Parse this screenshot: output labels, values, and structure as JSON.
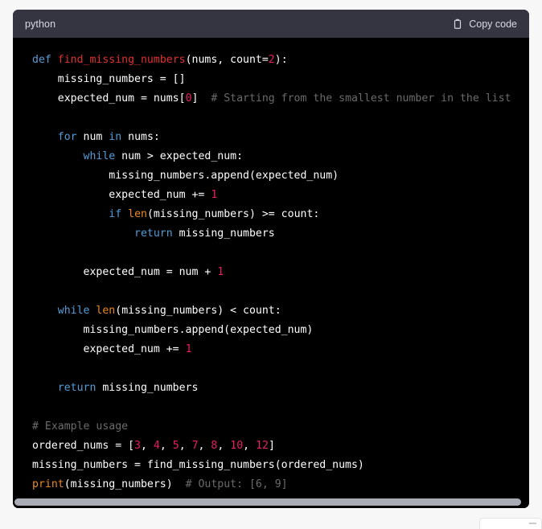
{
  "code_block": {
    "language_label": "python",
    "copy_button_label": "Copy code",
    "copy_icon": "clipboard-icon",
    "scrollbar": {
      "orientation": "horizontal",
      "visible": true
    },
    "colors": {
      "page_background": "#f7f7f8",
      "header_background": "#343541",
      "code_background": "#000000",
      "keyword": "#569cd6",
      "function_name": "#e03131",
      "number": "#e91e63",
      "builtin": "#e8892a",
      "comment": "#6b6b6b",
      "plain_text": "#ffffff",
      "scrollbar_thumb": "#a9abb5"
    },
    "lines": [
      {
        "n": 1,
        "tokens": [
          {
            "t": "def",
            "c": "kw"
          },
          {
            "t": " ",
            "c": "pl"
          },
          {
            "t": "find_missing_numbers",
            "c": "fn"
          },
          {
            "t": "(nums, count=",
            "c": "pl"
          },
          {
            "t": "2",
            "c": "num"
          },
          {
            "t": "):",
            "c": "pl"
          }
        ]
      },
      {
        "n": 2,
        "tokens": [
          {
            "t": "    missing_numbers = []",
            "c": "pl"
          }
        ]
      },
      {
        "n": 3,
        "tokens": [
          {
            "t": "    expected_num = nums[",
            "c": "pl"
          },
          {
            "t": "0",
            "c": "num"
          },
          {
            "t": "]  ",
            "c": "pl"
          },
          {
            "t": "# Starting from the smallest number in the list",
            "c": "cmt"
          }
        ]
      },
      {
        "n": 4,
        "tokens": [
          {
            "t": "",
            "c": "pl"
          }
        ]
      },
      {
        "n": 5,
        "tokens": [
          {
            "t": "    ",
            "c": "pl"
          },
          {
            "t": "for",
            "c": "kw"
          },
          {
            "t": " num ",
            "c": "pl"
          },
          {
            "t": "in",
            "c": "kw"
          },
          {
            "t": " nums:",
            "c": "pl"
          }
        ]
      },
      {
        "n": 6,
        "tokens": [
          {
            "t": "        ",
            "c": "pl"
          },
          {
            "t": "while",
            "c": "kw"
          },
          {
            "t": " num > expected_num:",
            "c": "pl"
          }
        ]
      },
      {
        "n": 7,
        "tokens": [
          {
            "t": "            missing_numbers.append(expected_num)",
            "c": "pl"
          }
        ]
      },
      {
        "n": 8,
        "tokens": [
          {
            "t": "            expected_num += ",
            "c": "pl"
          },
          {
            "t": "1",
            "c": "num"
          }
        ]
      },
      {
        "n": 9,
        "tokens": [
          {
            "t": "            ",
            "c": "pl"
          },
          {
            "t": "if",
            "c": "kw"
          },
          {
            "t": " ",
            "c": "pl"
          },
          {
            "t": "len",
            "c": "bi"
          },
          {
            "t": "(missing_numbers) >= count:",
            "c": "pl"
          }
        ]
      },
      {
        "n": 10,
        "tokens": [
          {
            "t": "                ",
            "c": "pl"
          },
          {
            "t": "return",
            "c": "kw"
          },
          {
            "t": " missing_numbers",
            "c": "pl"
          }
        ]
      },
      {
        "n": 11,
        "tokens": [
          {
            "t": "",
            "c": "pl"
          }
        ]
      },
      {
        "n": 12,
        "tokens": [
          {
            "t": "        expected_num = num + ",
            "c": "pl"
          },
          {
            "t": "1",
            "c": "num"
          }
        ]
      },
      {
        "n": 13,
        "tokens": [
          {
            "t": "",
            "c": "pl"
          }
        ]
      },
      {
        "n": 14,
        "tokens": [
          {
            "t": "    ",
            "c": "pl"
          },
          {
            "t": "while",
            "c": "kw"
          },
          {
            "t": " ",
            "c": "pl"
          },
          {
            "t": "len",
            "c": "bi"
          },
          {
            "t": "(missing_numbers) < count:",
            "c": "pl"
          }
        ]
      },
      {
        "n": 15,
        "tokens": [
          {
            "t": "        missing_numbers.append(expected_num)",
            "c": "pl"
          }
        ]
      },
      {
        "n": 16,
        "tokens": [
          {
            "t": "        expected_num += ",
            "c": "pl"
          },
          {
            "t": "1",
            "c": "num"
          }
        ]
      },
      {
        "n": 17,
        "tokens": [
          {
            "t": "",
            "c": "pl"
          }
        ]
      },
      {
        "n": 18,
        "tokens": [
          {
            "t": "    ",
            "c": "pl"
          },
          {
            "t": "return",
            "c": "kw"
          },
          {
            "t": " missing_numbers",
            "c": "pl"
          }
        ]
      },
      {
        "n": 19,
        "tokens": [
          {
            "t": "",
            "c": "pl"
          }
        ]
      },
      {
        "n": 20,
        "tokens": [
          {
            "t": "# Example usage",
            "c": "cmt"
          }
        ]
      },
      {
        "n": 21,
        "tokens": [
          {
            "t": "ordered_nums = [",
            "c": "pl"
          },
          {
            "t": "3",
            "c": "num"
          },
          {
            "t": ", ",
            "c": "pl"
          },
          {
            "t": "4",
            "c": "num"
          },
          {
            "t": ", ",
            "c": "pl"
          },
          {
            "t": "5",
            "c": "num"
          },
          {
            "t": ", ",
            "c": "pl"
          },
          {
            "t": "7",
            "c": "num"
          },
          {
            "t": ", ",
            "c": "pl"
          },
          {
            "t": "8",
            "c": "num"
          },
          {
            "t": ", ",
            "c": "pl"
          },
          {
            "t": "10",
            "c": "num"
          },
          {
            "t": ", ",
            "c": "pl"
          },
          {
            "t": "12",
            "c": "num"
          },
          {
            "t": "]",
            "c": "pl"
          }
        ]
      },
      {
        "n": 22,
        "tokens": [
          {
            "t": "missing_numbers = find_missing_numbers(ordered_nums)",
            "c": "pl"
          }
        ]
      },
      {
        "n": 23,
        "tokens": [
          {
            "t": "print",
            "c": "bi"
          },
          {
            "t": "(missing_numbers)  ",
            "c": "pl"
          },
          {
            "t": "# Output: [6, 9]",
            "c": "cmt"
          }
        ]
      }
    ]
  }
}
